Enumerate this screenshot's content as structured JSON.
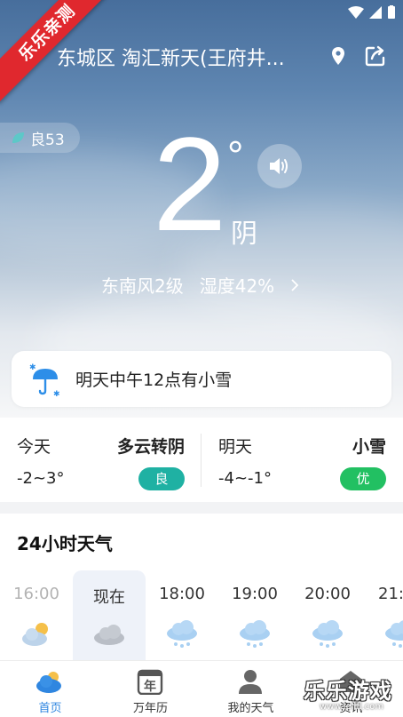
{
  "ribbon": {
    "text": "乐乐亲测"
  },
  "header": {
    "location": "东城区 淘汇新天(王府井..."
  },
  "aqi": {
    "label": "良53",
    "color": "#5dc8c8"
  },
  "current": {
    "temperature": "2",
    "degree": "°",
    "condition": "阴",
    "wind": "东南风2级",
    "humidity": "湿度42%"
  },
  "alert": {
    "text": "明天中午12点有小雪"
  },
  "forecast": [
    {
      "day": "今天",
      "weather": "多云转阴",
      "temp": "-2~3°",
      "aqi": "良",
      "aqi_color": "#1fb1a3"
    },
    {
      "day": "明天",
      "weather": "小雪",
      "temp": "-4~-1°",
      "aqi": "优",
      "aqi_color": "#22c062"
    }
  ],
  "hourly": {
    "title": "24小时天气",
    "items": [
      {
        "time": "16:00",
        "icon": "partly-cloudy-icon",
        "past": true
      },
      {
        "time": "现在",
        "icon": "cloudy-icon",
        "current": true
      },
      {
        "time": "18:00",
        "icon": "snow-icon"
      },
      {
        "time": "19:00",
        "icon": "snow-icon"
      },
      {
        "time": "20:00",
        "icon": "snow-icon"
      },
      {
        "time": "21:",
        "icon": "snow-icon"
      }
    ]
  },
  "nav": {
    "items": [
      {
        "label": "首页",
        "icon": "home-weather-icon",
        "active": true
      },
      {
        "label": "万年历",
        "icon": "calendar-icon",
        "calendar_char": "年"
      },
      {
        "label": "我的天气",
        "icon": "person-icon"
      },
      {
        "label": "资讯",
        "icon": "news-icon"
      }
    ]
  },
  "watermark": {
    "text": "乐乐游戏",
    "url": "www.lellfl.com"
  }
}
